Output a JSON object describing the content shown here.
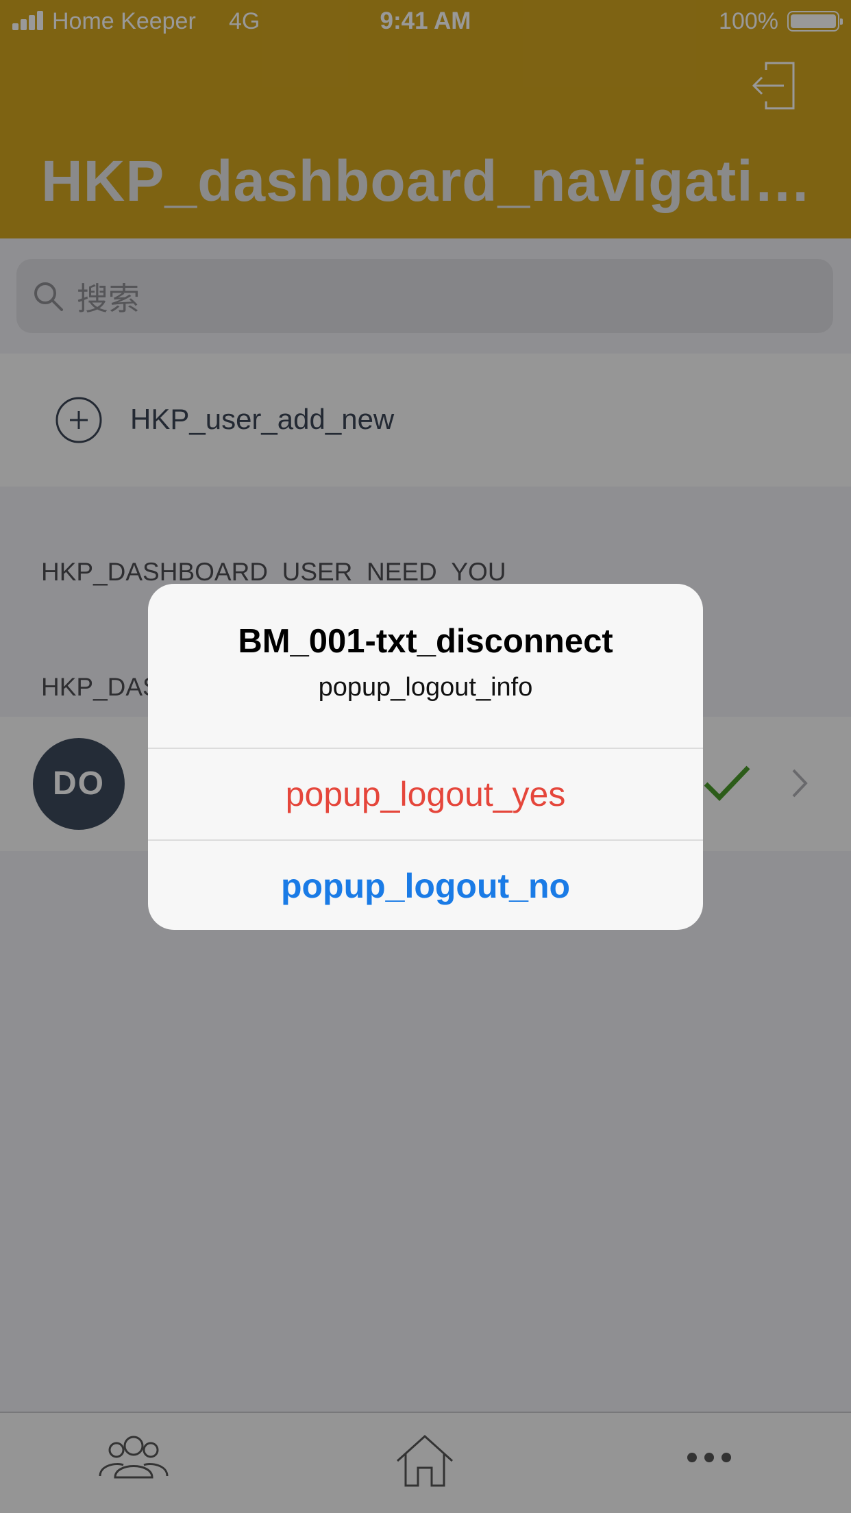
{
  "status_bar": {
    "carrier": "Home Keeper",
    "network": "4G",
    "time": "9:41 AM",
    "battery": "100%"
  },
  "header": {
    "title": "HKP_dashboard_navigatio...",
    "logout_icon": "logout-icon",
    "accent_color": "#d2a51f"
  },
  "search": {
    "placeholder": "搜索"
  },
  "add_user": {
    "label": "HKP_user_add_new"
  },
  "sections": {
    "need_you": "HKP_DASHBOARD_USER_NEED_YOU",
    "second": "HKP_DAS"
  },
  "user": {
    "initials": "DO",
    "status_icon": "checkmark-icon",
    "status_color": "#4a9a2a"
  },
  "tabs": [
    {
      "icon": "users-icon"
    },
    {
      "icon": "home-icon"
    },
    {
      "icon": "more-icon"
    }
  ],
  "alert": {
    "title": "BM_001-txt_disconnect",
    "message": "popup_logout_info",
    "yes_label": "popup_logout_yes",
    "no_label": "popup_logout_no",
    "yes_color": "#e5463b",
    "no_color": "#1a7be6"
  }
}
